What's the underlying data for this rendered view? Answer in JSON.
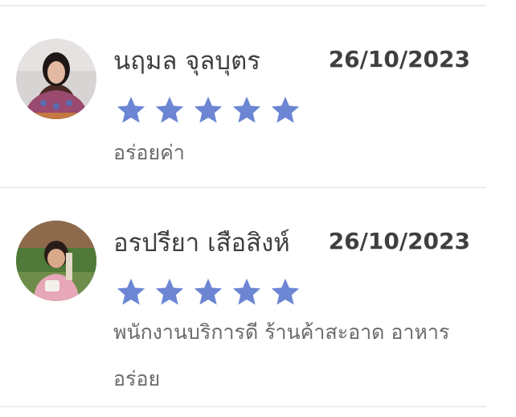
{
  "reviews": [
    {
      "name": "นฤมล จุลบุตร",
      "date": "26/10/2023",
      "rating": 5,
      "max_rating": 5,
      "comment": "อร่อยค่า",
      "avatar_icon": "user-photo-avatar"
    },
    {
      "name": "อรปรียา เสือสิงห์",
      "date": "26/10/2023",
      "rating": 5,
      "max_rating": 5,
      "comment": "พนักงานบริการดี ร้านค้าสะอาด อาหารอร่อย",
      "avatar_icon": "user-photo-avatar"
    }
  ],
  "colors": {
    "star": "#6c86d4",
    "star_empty": "#d9d9d9",
    "name_text": "#3f3f3f",
    "comment_text": "#6b6b6b",
    "divider": "#ececec"
  }
}
